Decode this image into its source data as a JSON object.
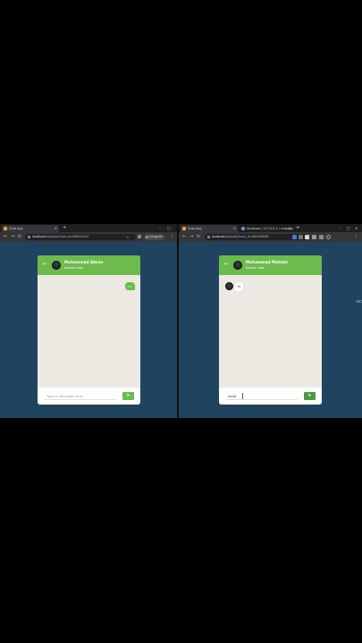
{
  "left": {
    "tab": {
      "title": "Chat App"
    },
    "address": {
      "host": "localhost",
      "path": "/chat.php?user_id=948514297"
    },
    "incognito_label": "Incognito",
    "chat": {
      "user_name": "Muhammad Ahsan",
      "status": "Active now",
      "messages": [
        {
          "direction": "outgoing",
          "text": "hi"
        }
      ],
      "input_value": "",
      "input_placeholder": "Type a message here...",
      "send_icon": "send-icon"
    }
  },
  "right": {
    "tabs": [
      {
        "title": "Chat App"
      },
      {
        "title": "localhost / 127.0.0.1 / chatapp"
      }
    ],
    "address": {
      "host": "localhost",
      "path": "/chat.php?user_id=963058660"
    },
    "chat": {
      "user_name": "Muhammad Mutahir",
      "status": "Active now",
      "messages": [
        {
          "direction": "incoming",
          "text": "hi"
        }
      ],
      "input_value": "hello",
      "input_placeholder": "Type a message here...",
      "send_icon": "send-icon"
    }
  },
  "colors": {
    "accent": "#6dbb4c",
    "page_bg": "#20445f",
    "chat_bg": "#ebe9e2"
  }
}
